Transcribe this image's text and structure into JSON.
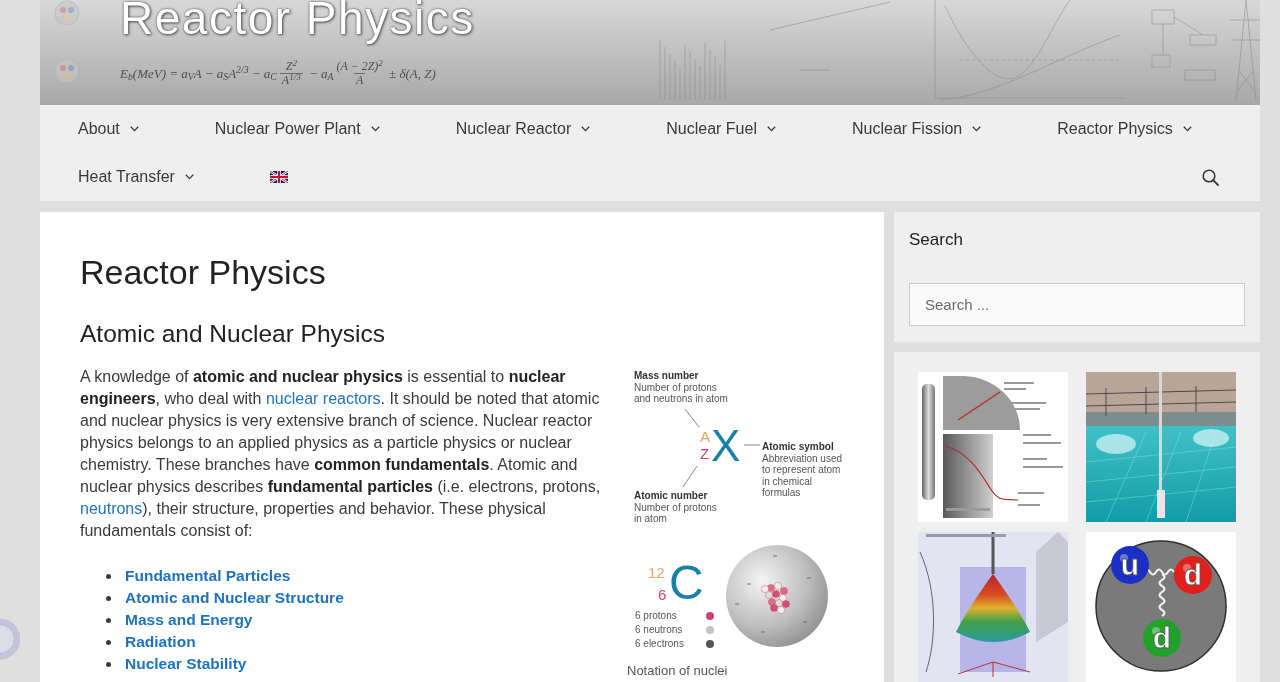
{
  "header": {
    "site_title": "Reactor Physics",
    "formula": [
      {
        "kind": "text",
        "text": "E$_{b}$(MeV) = a$_{V}$A − a$_{S}$A$^{2/3}$ − a$_{C}$"
      },
      {
        "kind": "fraction",
        "top": "Z$^{2}$",
        "bottom": "A$^{1/3}$"
      },
      {
        "kind": "text",
        "text": " − a$_{A}$"
      },
      {
        "kind": "fraction",
        "top": "(A − 2Z)$^{2}$",
        "bottom": "A"
      },
      {
        "kind": "text",
        "text": " ± δ(A, Z)"
      }
    ]
  },
  "nav": {
    "items": [
      {
        "label": "About",
        "dropdown": true
      },
      {
        "label": "Nuclear Power Plant",
        "dropdown": true
      },
      {
        "label": "Nuclear Reactor",
        "dropdown": true
      },
      {
        "label": "Nuclear Fuel",
        "dropdown": true
      },
      {
        "label": "Nuclear Fission",
        "dropdown": true
      },
      {
        "label": "Reactor Physics",
        "dropdown": true
      },
      {
        "label": "Heat Transfer",
        "dropdown": true
      }
    ]
  },
  "article": {
    "title": "Reactor Physics",
    "heading": "Atomic and Nuclear Physics",
    "paragraph": [
      {
        "kind": "text",
        "text": "A knowledge of **atomic and nuclear physics** is essential to **nuclear engineers**, who deal with "
      },
      {
        "kind": "link",
        "text": "nuclear reactors"
      },
      {
        "kind": "text",
        "text": ". It should be noted that atomic and nuclear physics is very extensive branch of science. Nuclear reactor physics belongs to an applied physics as a particle physics or nuclear chemistry. These branches have **common fundamentals**. Atomic and nuclear physics describes **fundamental particles** (i.e. electrons, protons, "
      },
      {
        "kind": "link",
        "text": "neutrons"
      },
      {
        "kind": "text",
        "text": "), their structure, properties and behavior. These physical fundamentals consist of:"
      }
    ],
    "topics": [
      "Fundamental Particles",
      "Atomic and Nuclear Structure",
      "Mass and Energy",
      "Radiation",
      "Nuclear Stability"
    ],
    "figure": {
      "symbol": {
        "mass": "A",
        "number": "Z",
        "element": "X"
      },
      "callouts": [
        {
          "kind": "mass",
          "title": "Mass number",
          "lines": [
            "Number of protons",
            "and neutrons in atom"
          ]
        },
        {
          "kind": "symbol",
          "title": "Atomic symbol",
          "lines": [
            "Abbreviation used",
            "to represent atom",
            "in chemical",
            "formulas"
          ]
        },
        {
          "kind": "number",
          "title": "Atomic number",
          "lines": [
            "Number of protons",
            "in atom"
          ]
        }
      ],
      "example": {
        "mass": "12",
        "number": "6",
        "element": "C"
      },
      "legend": [
        {
          "label": "6 protons",
          "color": "#d6406e"
        },
        {
          "label": "6 neutrons",
          "color": "#c4c4c4"
        },
        {
          "label": "6 electrons",
          "color": "#555555"
        }
      ],
      "caption": "Notation of nuclei"
    }
  },
  "sidebar": {
    "search": {
      "title": "Search",
      "placeholder": "Search ..."
    },
    "gallery": [
      {
        "kind": "diagram"
      },
      {
        "kind": "photo"
      },
      {
        "kind": "plot"
      },
      {
        "kind": "quarks",
        "quarks": [
          {
            "label": "u",
            "color": "#1c2fc4"
          },
          {
            "label": "d",
            "color": "#e0201c"
          },
          {
            "label": "d",
            "color": "#22a22a"
          }
        ]
      }
    ]
  }
}
